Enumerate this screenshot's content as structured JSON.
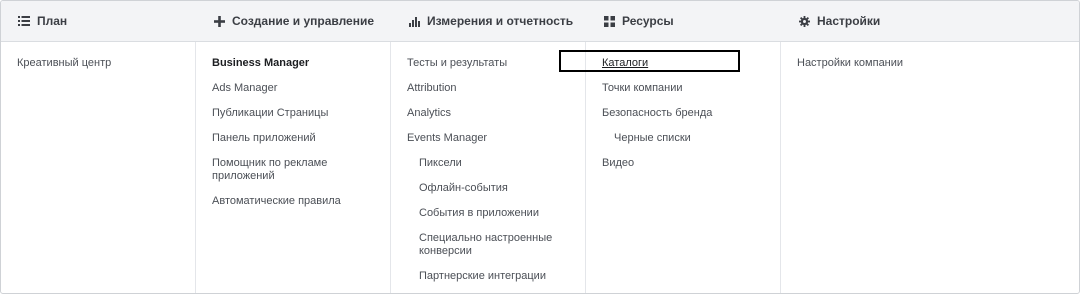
{
  "columns": [
    {
      "title": "План",
      "icon": "list-icon",
      "items": [
        {
          "label": "Креативный центр"
        }
      ]
    },
    {
      "title": "Создание и управление",
      "icon": "plus-icon",
      "items": [
        {
          "label": "Business Manager"
        },
        {
          "label": "Ads Manager"
        },
        {
          "label": "Публикации Страницы"
        },
        {
          "label": "Панель приложений"
        },
        {
          "label": "Помощник по рекламе приложений"
        },
        {
          "label": "Автоматические правила"
        }
      ]
    },
    {
      "title": "Измерения и отчетность",
      "icon": "bar-chart-icon",
      "items": [
        {
          "label": "Тесты и результаты"
        },
        {
          "label": "Attribution"
        },
        {
          "label": "Analytics"
        },
        {
          "label": "Events Manager"
        },
        {
          "label": "Пиксели"
        },
        {
          "label": "Офлайн-события"
        },
        {
          "label": "События в приложении"
        },
        {
          "label": "Специально настроенные конверсии"
        },
        {
          "label": "Партнерские интеграции"
        }
      ]
    },
    {
      "title": "Ресурсы",
      "icon": "grid-icon",
      "items": [
        {
          "label": "Каталоги"
        },
        {
          "label": "Точки компании"
        },
        {
          "label": "Безопасность бренда"
        },
        {
          "label": "Черные списки"
        },
        {
          "label": "Видео"
        }
      ]
    },
    {
      "title": "Настройки",
      "icon": "gear-icon",
      "items": [
        {
          "label": "Настройки компании"
        }
      ]
    }
  ]
}
